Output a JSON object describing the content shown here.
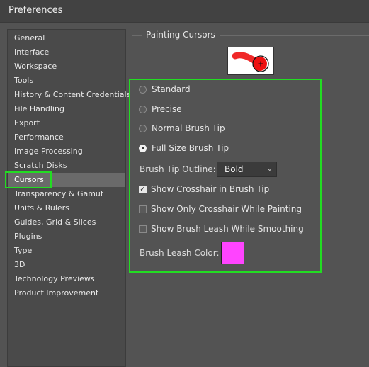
{
  "window": {
    "title": "Preferences"
  },
  "sidebar": {
    "items": [
      {
        "label": "General"
      },
      {
        "label": "Interface"
      },
      {
        "label": "Workspace"
      },
      {
        "label": "Tools"
      },
      {
        "label": "History & Content Credentials"
      },
      {
        "label": "File Handling"
      },
      {
        "label": "Export"
      },
      {
        "label": "Performance"
      },
      {
        "label": "Image Processing"
      },
      {
        "label": "Scratch Disks"
      },
      {
        "label": "Cursors"
      },
      {
        "label": "Transparency & Gamut"
      },
      {
        "label": "Units & Rulers"
      },
      {
        "label": "Guides, Grid & Slices"
      },
      {
        "label": "Plugins"
      },
      {
        "label": "Type"
      },
      {
        "label": "3D"
      },
      {
        "label": "Technology Previews"
      },
      {
        "label": "Product Improvement"
      }
    ],
    "selected": "Cursors"
  },
  "painting_cursors": {
    "group_title": "Painting Cursors",
    "options": {
      "standard": "Standard",
      "precise": "Precise",
      "normal_brush_tip": "Normal Brush Tip",
      "full_size_brush_tip": "Full Size Brush Tip"
    },
    "selected_option": "Full Size Brush Tip",
    "brush_tip_outline": {
      "label": "Brush Tip Outline:",
      "value": "Bold"
    },
    "checks": {
      "show_crosshair": {
        "label": "Show Crosshair in Brush Tip",
        "checked": true
      },
      "show_only_crosshair": {
        "label": "Show Only Crosshair While Painting",
        "checked": false
      },
      "show_brush_leash": {
        "label": "Show Brush Leash While Smoothing",
        "checked": false
      }
    },
    "brush_leash_color": {
      "label": "Brush Leash Color:",
      "color": "#ff44ff"
    }
  },
  "colors": {
    "highlight": "#22dd22",
    "preview_stroke": "#ee1111"
  }
}
